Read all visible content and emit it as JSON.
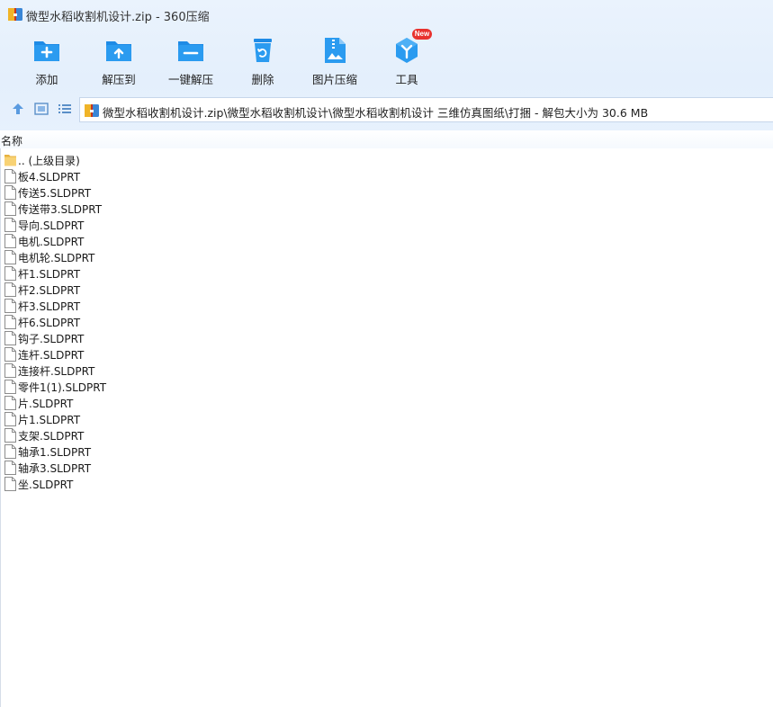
{
  "window": {
    "title": "微型水稻收割机设计.zip - 360压缩"
  },
  "toolbar": {
    "items": [
      {
        "label": "添加",
        "icon": "add-folder-icon"
      },
      {
        "label": "解压到",
        "icon": "extract-to-icon"
      },
      {
        "label": "一键解压",
        "icon": "one-click-extract-icon"
      },
      {
        "label": "删除",
        "icon": "recycle-bin-icon"
      },
      {
        "label": "图片压缩",
        "icon": "image-compress-icon"
      },
      {
        "label": "工具",
        "icon": "tools-icon",
        "badge": "New"
      }
    ]
  },
  "nav": {
    "path": "微型水稻收割机设计.zip\\微型水稻收割机设计\\微型水稻收割机设计 三维仿真图纸\\打捆 - 解包大小为 30.6 MB"
  },
  "list": {
    "column_name": "名称",
    "items": [
      {
        "name": ".. (上级目录)",
        "type": "folder"
      },
      {
        "name": "板4.SLDPRT",
        "type": "file"
      },
      {
        "name": "传送5.SLDPRT",
        "type": "file"
      },
      {
        "name": "传送带3.SLDPRT",
        "type": "file"
      },
      {
        "name": "导向.SLDPRT",
        "type": "file"
      },
      {
        "name": "电机.SLDPRT",
        "type": "file"
      },
      {
        "name": "电机轮.SLDPRT",
        "type": "file"
      },
      {
        "name": "杆1.SLDPRT",
        "type": "file"
      },
      {
        "name": "杆2.SLDPRT",
        "type": "file"
      },
      {
        "name": "杆3.SLDPRT",
        "type": "file"
      },
      {
        "name": "杆6.SLDPRT",
        "type": "file"
      },
      {
        "name": "钩子.SLDPRT",
        "type": "file"
      },
      {
        "name": "连杆.SLDPRT",
        "type": "file"
      },
      {
        "name": "连接杆.SLDPRT",
        "type": "file"
      },
      {
        "name": "零件1(1).SLDPRT",
        "type": "file"
      },
      {
        "name": "片.SLDPRT",
        "type": "file"
      },
      {
        "name": "片1.SLDPRT",
        "type": "file"
      },
      {
        "name": "支架.SLDPRT",
        "type": "file"
      },
      {
        "name": "轴承1.SLDPRT",
        "type": "file"
      },
      {
        "name": "轴承3.SLDPRT",
        "type": "file"
      },
      {
        "name": "坐.SLDPRT",
        "type": "file"
      }
    ]
  },
  "colors": {
    "accent": "#1e8be6",
    "badge": "#e8322e",
    "folder": "#f5c451"
  }
}
